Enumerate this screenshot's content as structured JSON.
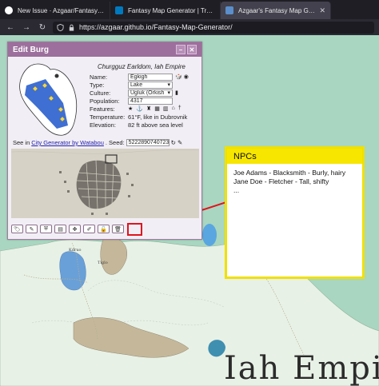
{
  "browser": {
    "tabs": [
      {
        "title": "New Issue · Azgaar/Fantasy-Ma",
        "active": false,
        "icon": "github-icon"
      },
      {
        "title": "Fantasy Map Generator | Trello",
        "active": false,
        "icon": "trello-icon"
      },
      {
        "title": "Azgaar's Fantasy Map Generato",
        "active": true,
        "icon": "fmg-icon"
      }
    ],
    "url": "https://azgaar.github.io/Fantasy-Map-Generator/"
  },
  "dialog": {
    "title": "Edit Burg",
    "state_line": "Churgguz Earldom, Iah Empire",
    "fields": [
      {
        "label": "Name:",
        "value": "Egkigh",
        "kind": "input"
      },
      {
        "label": "Type:",
        "value": "Lake",
        "kind": "select"
      },
      {
        "label": "Culture:",
        "value": "Ugluk (Orkish",
        "kind": "select"
      },
      {
        "label": "Population:",
        "value": "4317",
        "kind": "input"
      },
      {
        "label": "Features:",
        "value": "",
        "kind": "icons"
      },
      {
        "label": "Temperature:",
        "value": "61°F, like in Dubrovnik",
        "kind": "text"
      },
      {
        "label": "Elevation:",
        "value": "82 ft above sea level",
        "kind": "text"
      }
    ],
    "seed": {
      "prefix": "See in",
      "link": "City Generator by Watabou",
      "label": ". Seed:",
      "value": "5222890740723"
    }
  },
  "toolbar_icons": [
    "tag-icon",
    "brush-icon",
    "shield-icon",
    "map-icon",
    "move-icon",
    "edit-icon",
    "unlock-icon",
    "trash-icon"
  ],
  "npc_note": {
    "heading": "NPCs",
    "lines": [
      "Joe Adams - Blacksmith - Burly, hairy",
      "Jane Doe - Fletcher - Tall, shifty",
      "..."
    ]
  },
  "map": {
    "empire_label": "Iah Empi",
    "labels": [
      "Tiglo",
      "Kdruo"
    ]
  },
  "colors": {
    "dialog_header": "#9c6f9c",
    "note_border": "#f0e000",
    "annotation_red": "#e0141e",
    "sea": "#a9d6c0"
  }
}
